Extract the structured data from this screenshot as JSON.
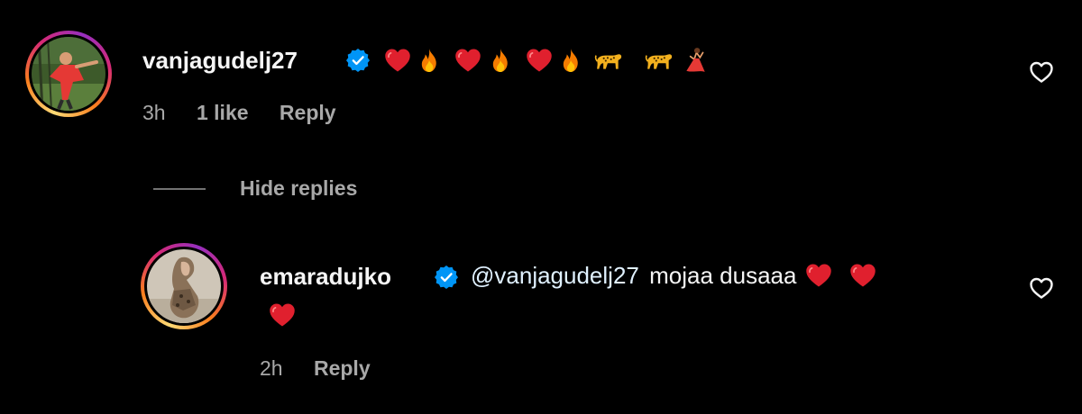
{
  "comments": [
    {
      "username": "vanjagudelj27",
      "verified": true,
      "time": "3h",
      "likes": "1 like",
      "reply_label": "Reply"
    }
  ],
  "hide_replies_label": "Hide replies",
  "replies": [
    {
      "username": "emaradujko",
      "verified": true,
      "mention": "@vanjagudelj27",
      "text": "mojaa dusaaa",
      "time": "2h",
      "reply_label": "Reply"
    }
  ],
  "icons": {
    "verified": "verified-badge-icon",
    "like": "heart-outline-icon",
    "emoji_heart": "red-heart-icon",
    "emoji_fire": "fire-icon",
    "emoji_leopard": "leopard-icon",
    "emoji_dancer": "dancer-icon"
  },
  "colors": {
    "background": "#000000",
    "text": "#f5f5f5",
    "secondary": "#a8a8a8",
    "verified": "#0095f6",
    "mention": "#e0f1ff"
  }
}
